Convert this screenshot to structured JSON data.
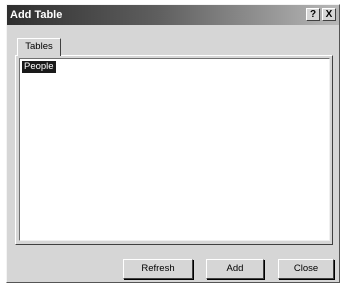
{
  "window": {
    "title": "Add Table",
    "help_label": "?",
    "close_label": "X"
  },
  "tabs": [
    {
      "label": "Tables",
      "selected": true
    }
  ],
  "list": {
    "items": [
      {
        "label": "People",
        "selected": true
      }
    ]
  },
  "buttons": {
    "refresh_label": "Refresh",
    "add_label": "Add",
    "close_label": "Close"
  }
}
